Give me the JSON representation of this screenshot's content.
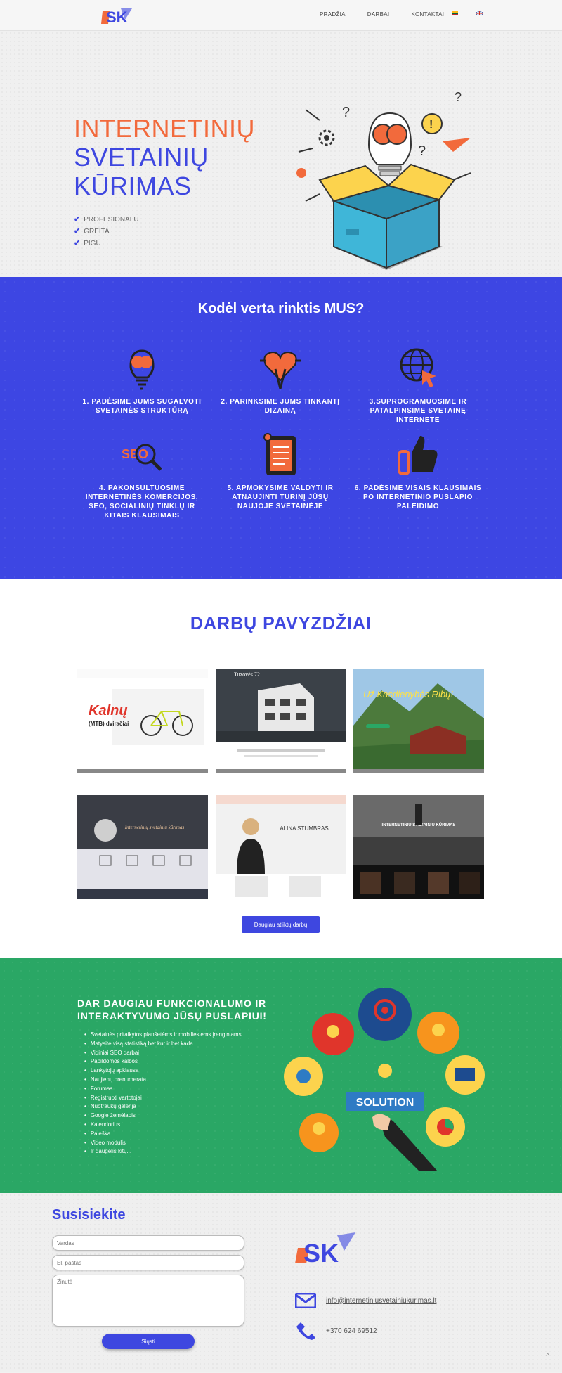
{
  "nav": {
    "items": [
      "PRADŽIA",
      "DARBAI",
      "KONTAKTAI"
    ]
  },
  "hero": {
    "title_line1": "INTERNETINIŲ",
    "title_line2": "SVETAINIŲ",
    "title_line3": "KŪRIMAS",
    "bullets": [
      "PROFESIONALU",
      "GREITA",
      "PIGU"
    ],
    "check_icon": "✔"
  },
  "why": {
    "title": "Kodėl verta rinktis MUS?",
    "features": [
      {
        "icon": "brain-bulb-icon",
        "label": "1. PADĖSIME JUMS SUGALVOTI SVETAINĖS STRUKTŪRĄ"
      },
      {
        "icon": "heart-pen-icon",
        "label": "2. PARINKSIME JUMS TINKANTĮ DIZAINĄ"
      },
      {
        "icon": "globe-cursor-icon",
        "label": "3.SUPROGRAMUOSIME IR PATALPINSIME SVETAINĘ INTERNETE"
      },
      {
        "icon": "seo-magnifier-icon",
        "label": "4. PAKONSULTUOSIME INTERNETINĖS KOMERCIJOS, SEO, SOCIALINIŲ TINKLŲ IR KITAIS KLAUSIMAIS"
      },
      {
        "icon": "document-clip-icon",
        "label": "5. APMOKYSIME VALDYTI IR ATNAUJINTI TURINĮ JŪSŲ NAUJOJE SVETAINĖJE"
      },
      {
        "icon": "thumbs-up-icon",
        "label": "6. PADĖSIME VISAIS KLAUSIMAIS PO INTERNETINIO PUSLAPIO PALEIDIMO"
      }
    ]
  },
  "works": {
    "title": "DARBŲ PAVYZDŽIAI",
    "more_label": "Daugiau atliktų darbų",
    "thumbs": {
      "t1_title": "Kalnų",
      "t1_sub": "(MTB) dviračiai",
      "t2_title": "Tuzovės 72",
      "t3_title": "Už Kasdienybės Ribų!",
      "t4_title": "Internetinių svetainių kūrimas",
      "t5_title": "ALINA STUMBRAS",
      "t6_title": "INTERNETINIŲ SVETAINIŲ KŪRIMAS"
    }
  },
  "features": {
    "title_line1": "DAR DAUGIAU FUNKCIONALUMO IR",
    "title_line2": "INTERAKTYVUMO JŪSŲ PUSLAPIUI!",
    "items": [
      "Svetainės pritaikytos planšetėms ir mobiliesiems įrenginiams.",
      "Matysite visą statistiką bet kur ir bet kada.",
      "Vidiniai SEO darbai",
      "Papildomos kalbos",
      "Lankytojų apklausa",
      "Naujienų prenumerata",
      "Forumas",
      "Registruoti vartotojai",
      "Nuotraukų galerija",
      "Google žemėlapis",
      "Kalendorius",
      "Paieška",
      "Video modulis",
      "Ir daugelis kitų..."
    ],
    "solution_label": "SOLUTION"
  },
  "contact": {
    "title": "Susisiekite",
    "name_placeholder": "Vardas",
    "email_placeholder": "El. paštas",
    "message_placeholder": "Žinutė",
    "send_label": "Siųsti",
    "email": "info@internetiniusvetainiukurimas.lt",
    "phone": "+370 624 69512",
    "up_arrow": "^"
  },
  "colors": {
    "blue": "#3e47e0",
    "orange": "#f26a3c",
    "green": "#2aa765"
  }
}
